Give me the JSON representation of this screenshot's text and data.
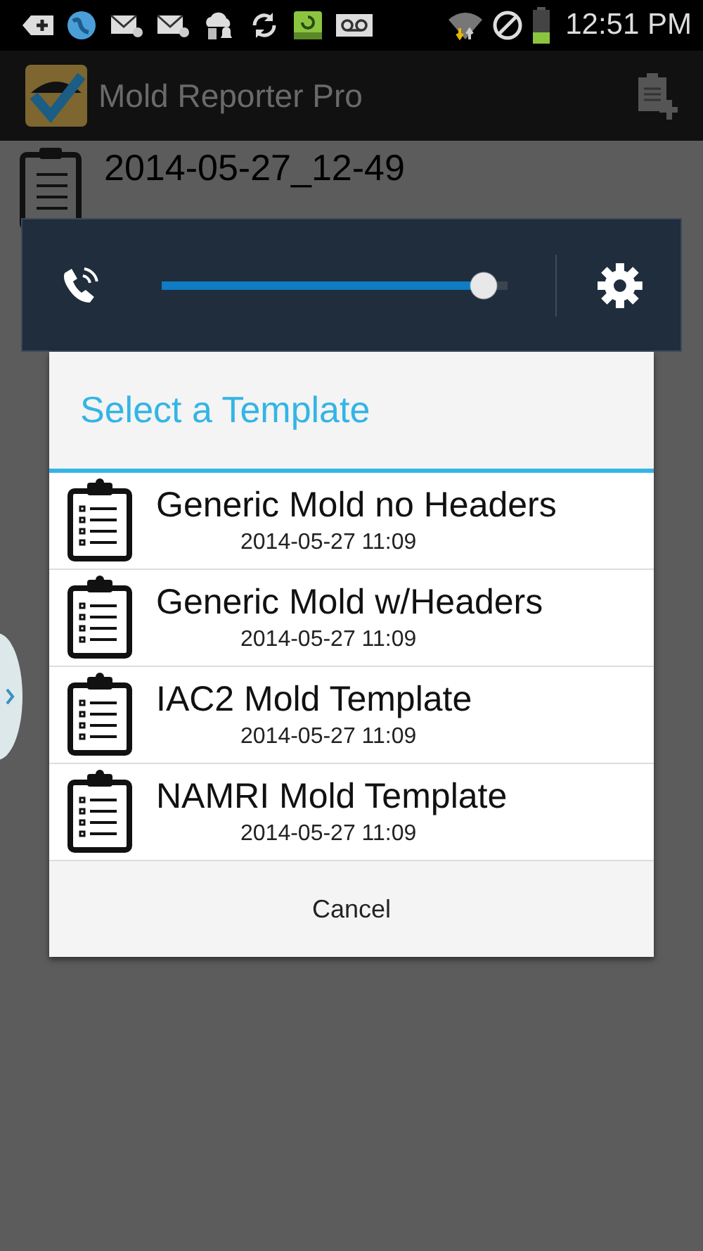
{
  "status_bar": {
    "time": "12:51 PM"
  },
  "action_bar": {
    "title": "Mold Reporter Pro"
  },
  "background_list": [
    {
      "title": "2014-05-27_12-49"
    }
  ],
  "volume_panel": {
    "level": 0.97
  },
  "dialog": {
    "title": "Select a Template",
    "items": [
      {
        "name": "Generic Mold no Headers",
        "date": "2014-05-27 11:09"
      },
      {
        "name": "Generic Mold w/Headers",
        "date": "2014-05-27 11:09"
      },
      {
        "name": "IAC2 Mold Template",
        "date": "2014-05-27 11:09"
      },
      {
        "name": "NAMRI Mold Template",
        "date": "2014-05-27 11:09"
      }
    ],
    "cancel": "Cancel"
  }
}
